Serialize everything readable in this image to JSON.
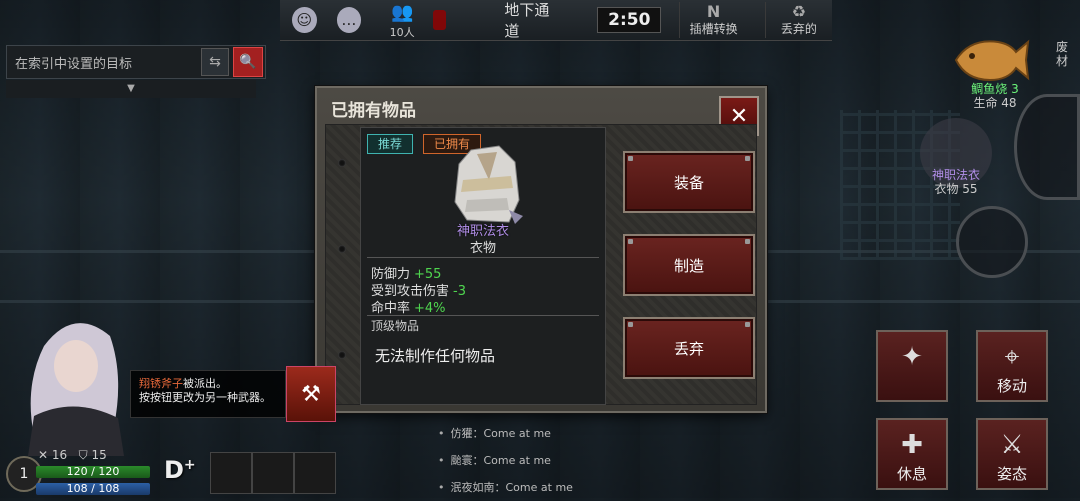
{
  "topbar": {
    "location": "地下通道",
    "time": "2:50",
    "people_count": "10人",
    "slot_switch_label": "插槽转换",
    "discard_label": "丢弃的"
  },
  "search": {
    "placeholder": "在索引中设置的目标"
  },
  "dialog": {
    "title": "已拥有物品",
    "badges": {
      "recommended": "推荐",
      "owned": "已拥有"
    },
    "item": {
      "name": "神职法衣",
      "type": "衣物",
      "stats": [
        {
          "label": "防御力",
          "value": "+55"
        },
        {
          "label": "受到攻击伤害",
          "value": "-3"
        },
        {
          "label": "命中率",
          "value": "+4%"
        }
      ],
      "grade": "顶级物品",
      "craft_note": "无法制作任何物品"
    },
    "actions": {
      "equip": "装备",
      "craft": "制造",
      "discard": "丢弃"
    }
  },
  "hud": {
    "fish": {
      "name": "鲷鱼烧",
      "count": "3",
      "hp": "生命 48"
    },
    "waste": {
      "line1": "废",
      "line2": "材"
    },
    "robe": {
      "name": "神职法衣",
      "sub": "衣物 55"
    },
    "move": "移动",
    "rest": "休息",
    "stance": "姿态"
  },
  "notice": {
    "weapon": "翔锈斧子",
    "line1_suffix": "被派出。",
    "line2": "按按钮更改为另一种武器。"
  },
  "character": {
    "level": "1",
    "attack": "16",
    "defense": "15",
    "hp": "120 / 120",
    "mp": "108 / 108",
    "rank": "D",
    "rank_mod": "+"
  },
  "chatlog": [
    {
      "user": "仿獾",
      "msg": "Come at me"
    },
    {
      "user": "颱寰",
      "msg": "Come at me"
    },
    {
      "user": "泯夜如南",
      "msg": "Come at me"
    }
  ]
}
